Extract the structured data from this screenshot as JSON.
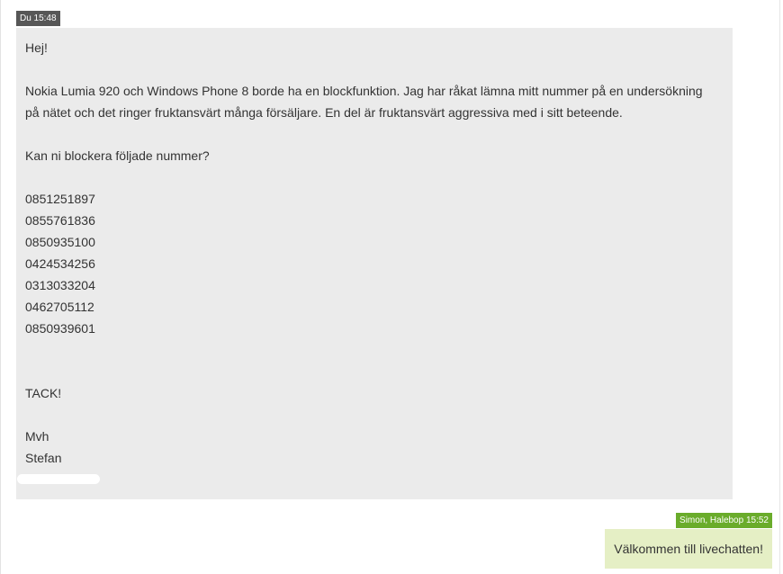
{
  "user_message": {
    "tag": "Du 15:48",
    "greeting": "Hej!",
    "body_line_1": "Nokia Lumia 920 och Windows Phone 8 borde ha en blockfunktion. Jag har råkat lämna mitt nummer på en undersökning",
    "body_line_2": "på nätet och det ringer fruktansvärt många försäljare. En del är fruktansvärt aggressiva med i sitt beteende.",
    "question": "Kan ni blockera följade nummer?",
    "numbers": [
      "0851251897",
      "0855761836",
      "0850935100",
      "0424534256",
      "0313033204",
      "0462705112",
      "0850939601"
    ],
    "thanks": "TACK!",
    "signoff": "Mvh",
    "name": "Stefan"
  },
  "agent_message": {
    "tag": "Simon, Halebop 15:52",
    "text": "Välkommen till livechatten!"
  }
}
